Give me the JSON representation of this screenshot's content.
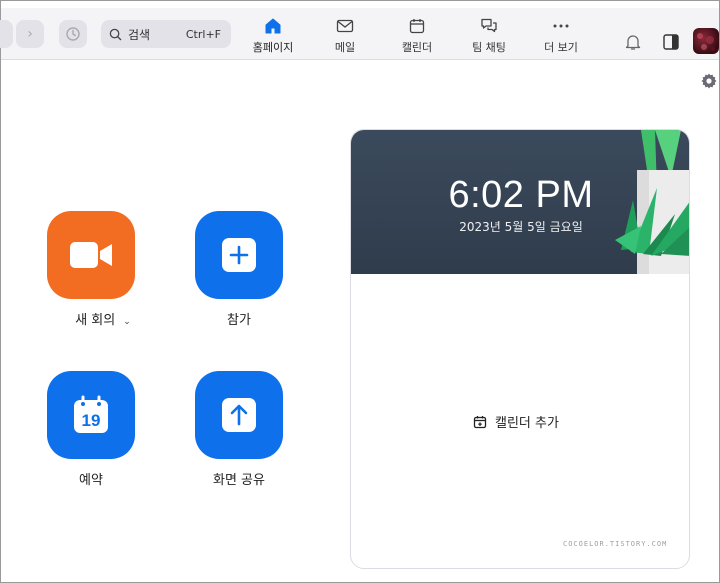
{
  "search": {
    "placeholder": "검색",
    "shortcut": "Ctrl+F"
  },
  "tabs": [
    {
      "label": "홈페이지",
      "icon": "home-icon",
      "active": true
    },
    {
      "label": "메일",
      "icon": "mail-icon"
    },
    {
      "label": "캘린더",
      "icon": "calendar-icon"
    },
    {
      "label": "팀 채팅",
      "icon": "chat-icon"
    },
    {
      "label": "더 보기",
      "icon": "more-icon"
    }
  ],
  "actions": {
    "new_meeting": "새 회의",
    "join": "참가",
    "schedule": "예약",
    "schedule_day": "19",
    "share_screen": "화면 공유"
  },
  "clock": {
    "time": "6:02 PM",
    "date": "2023년 5월 5일 금요일"
  },
  "calendar": {
    "add_label": "캘린더 추가"
  },
  "watermark": "COCOELOR.TISTORY.COM",
  "colors": {
    "accent": "#0e71eb",
    "new_meeting": "#f26d21",
    "header_bg": "#334152"
  }
}
